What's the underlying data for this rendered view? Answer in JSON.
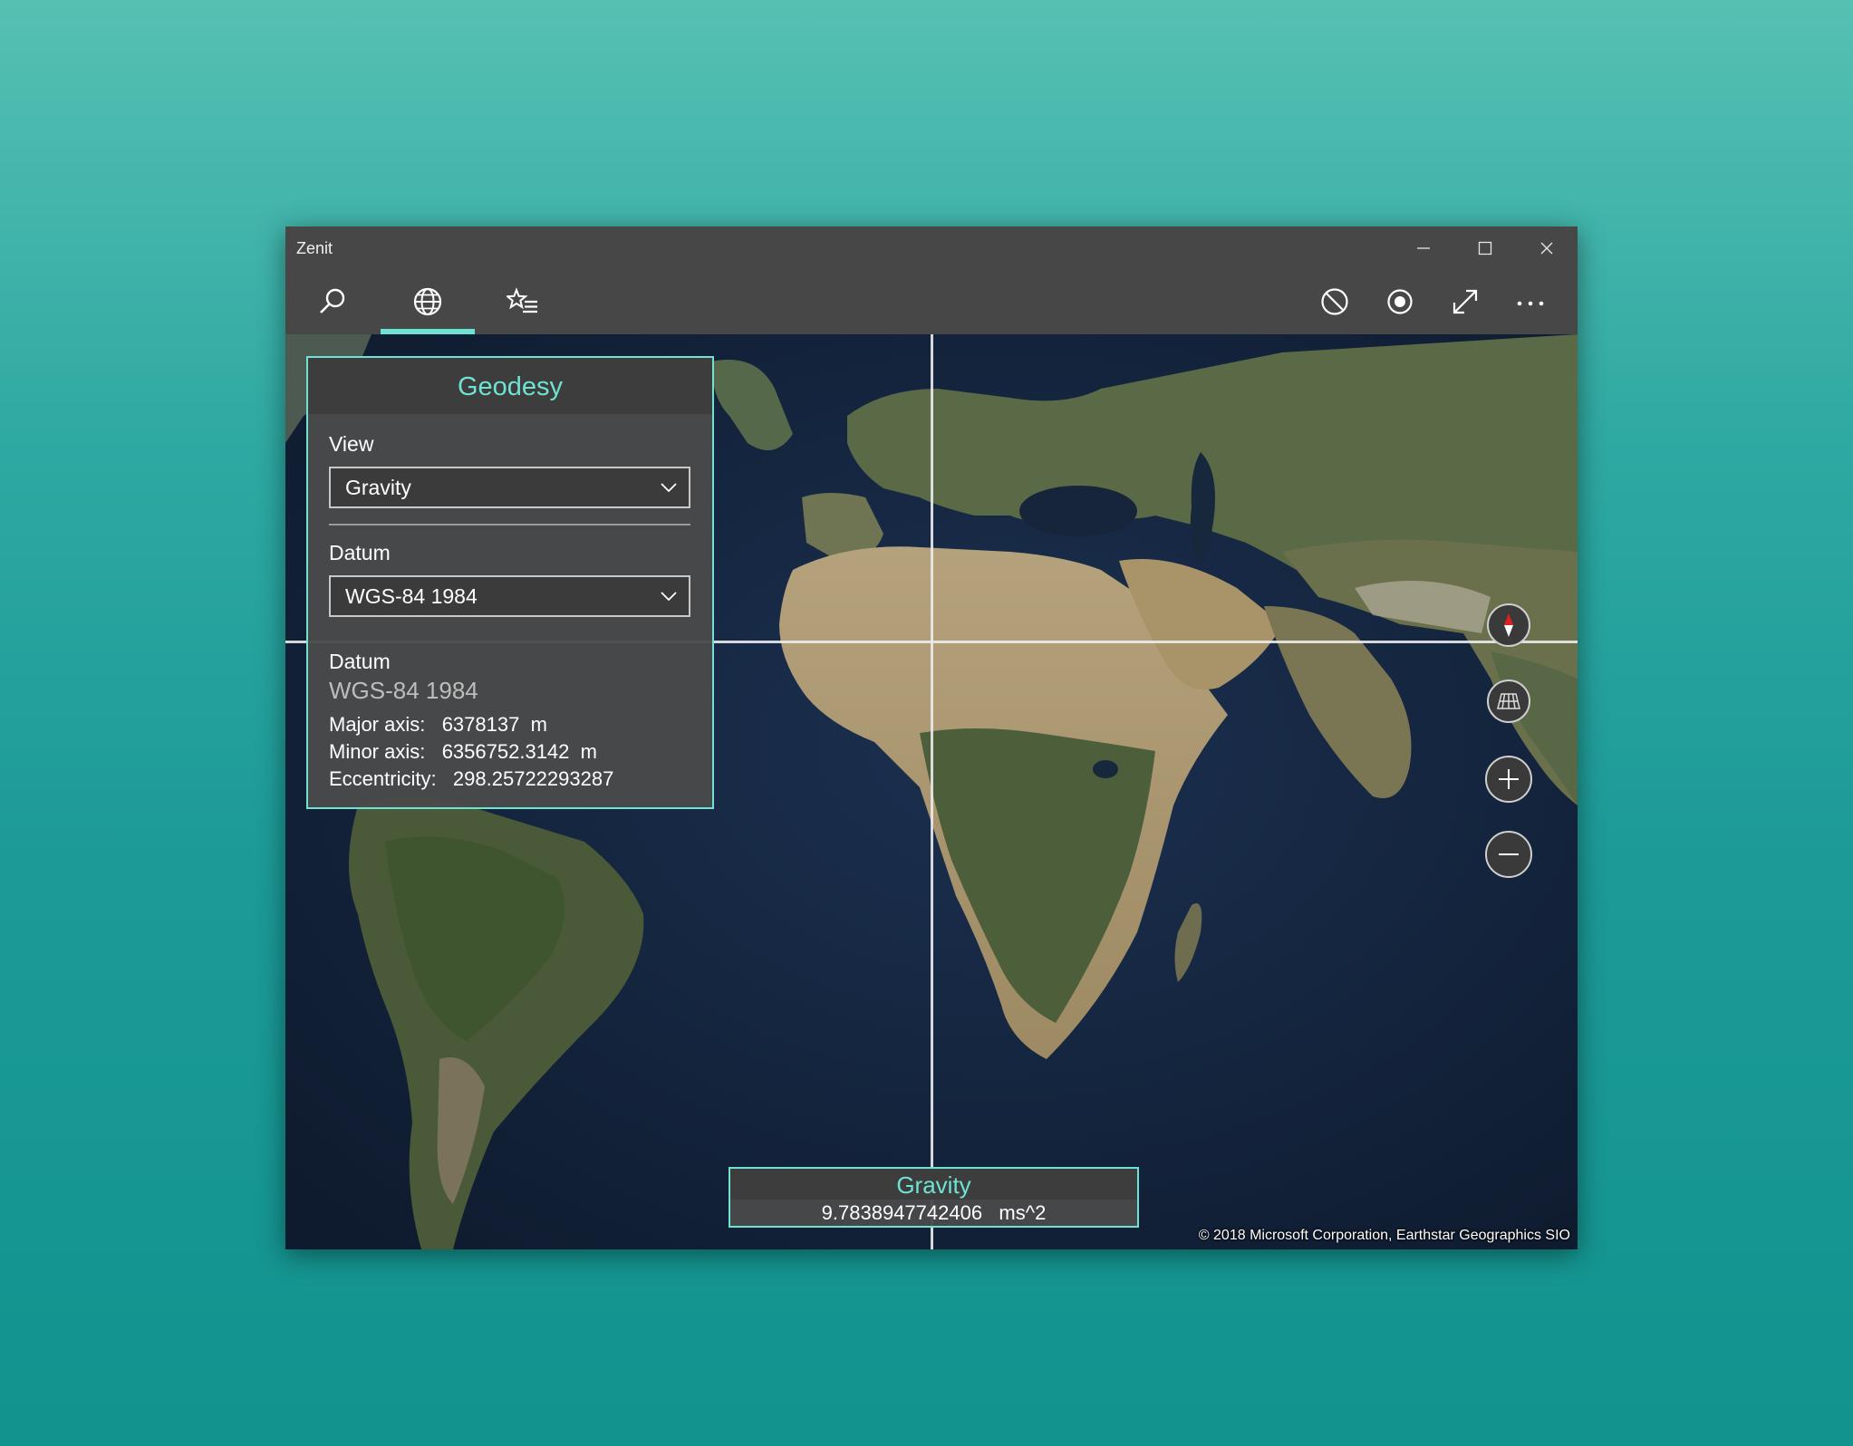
{
  "window": {
    "title": "Zenit"
  },
  "toolbar": {
    "left": [
      {
        "icon": "search-icon",
        "active": false
      },
      {
        "icon": "globe-icon",
        "active": true
      },
      {
        "icon": "favorites-list-icon",
        "active": false
      }
    ],
    "right": [
      "block-icon",
      "record-icon",
      "expand-icon",
      "more-icon"
    ]
  },
  "colors": {
    "accent": "#6fe3d3",
    "chrome": "#474747",
    "panel": "#4a4a4a"
  },
  "panel": {
    "title": "Geodesy",
    "view_label": "View",
    "view_value": "Gravity",
    "datum_label": "Datum",
    "datum_value": "WGS-84 1984",
    "info_label": "Datum",
    "info_name": "WGS-84 1984",
    "major_axis": "Major axis:   6378137  m",
    "minor_axis": "Minor axis:   6356752.3142  m",
    "eccentricity": "Eccentricity:   298.25722293287"
  },
  "map_controls": [
    "compass-icon",
    "tilt-grid-icon",
    "zoom-in-icon",
    "zoom-out-icon"
  ],
  "readout": {
    "title": "Gravity",
    "value": "9.7838947742406   ms^2"
  },
  "copyright": "© 2018 Microsoft Corporation, Earthstar Geographics  SIO"
}
